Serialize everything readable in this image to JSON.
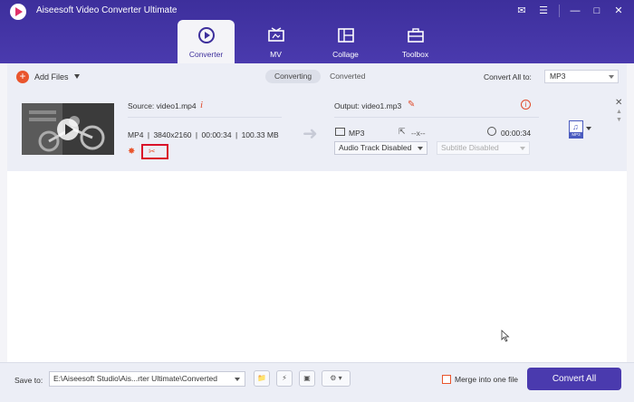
{
  "app": {
    "title": "Aiseesoft Video Converter Ultimate"
  },
  "tabs": [
    {
      "label": "Converter",
      "icon": "converter-icon",
      "active": true
    },
    {
      "label": "MV",
      "icon": "mv-icon",
      "active": false
    },
    {
      "label": "Collage",
      "icon": "collage-icon",
      "active": false
    },
    {
      "label": "Toolbox",
      "icon": "toolbox-icon",
      "active": false
    }
  ],
  "toolbar": {
    "add_files": "Add Files",
    "segments": {
      "converting": "Converting",
      "converted": "Converted"
    },
    "convert_all_to_label": "Convert All to:",
    "convert_all_to_value": "MP3"
  },
  "file": {
    "source": "Source: video1.mp4",
    "format": "MP4",
    "resolution": "3840x2160",
    "duration": "00:00:34",
    "size": "100.33 MB",
    "output": "Output: video1.mp3",
    "out_format": "MP3",
    "out_resolution": "--x--",
    "out_duration": "00:00:34",
    "audio_track": "Audio Track Disabled",
    "subtitle": "Subtitle Disabled",
    "format_badge": "MP3"
  },
  "bottom": {
    "save_to_label": "Save to:",
    "save_path": "E:\\Aiseesoft Studio\\Ais...rter Ultimate\\Converted",
    "merge_label": "Merge into one file",
    "convert_all_label": "Convert All"
  },
  "colors": {
    "brand": "#3d2f9c",
    "accent": "#e9552d",
    "button": "#4a3aae"
  }
}
